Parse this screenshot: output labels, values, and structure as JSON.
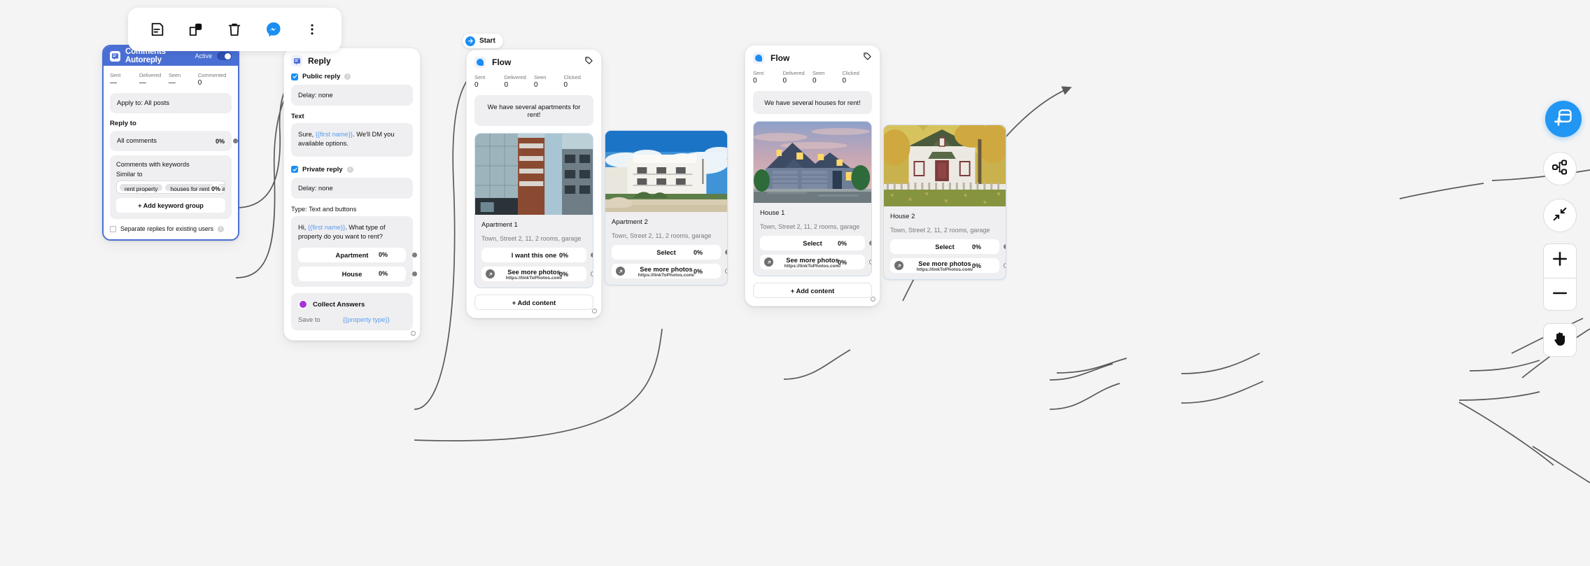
{
  "toolbar": {
    "buttons": [
      {
        "name": "notes-icon",
        "label": "Notes"
      },
      {
        "name": "duplicate-icon",
        "label": "Duplicate"
      },
      {
        "name": "trash-icon",
        "label": "Delete"
      },
      {
        "name": "messenger-icon",
        "label": "Messenger"
      },
      {
        "name": "more-vertical-icon",
        "label": "More"
      }
    ]
  },
  "start_badge": {
    "label": "Start"
  },
  "autoreply": {
    "title": "Comments Autoreply",
    "active_label": "Active",
    "stats": [
      {
        "label": "Sent",
        "value": "—"
      },
      {
        "label": "Delivered",
        "value": "—"
      },
      {
        "label": "Seen",
        "value": "—"
      },
      {
        "label": "Commented",
        "value": "0"
      }
    ],
    "apply_to": "Apply to: All posts",
    "reply_to_label": "Reply to",
    "all_comments": {
      "label": "All comments",
      "pct": "0%"
    },
    "keywords_block": {
      "title": "Comments with keywords",
      "similar_to_label": "Similar to",
      "chips": [
        "rent property",
        "houses for rent",
        "a"
      ],
      "pct": "0%",
      "add_button": "+ Add keyword group"
    },
    "separate_replies": "Separate replies for existing users"
  },
  "reply": {
    "title": "Reply",
    "public": {
      "label": "Public reply",
      "delay": "Delay:  none",
      "text_label": "Text",
      "message_prefix": "Sure, ",
      "message_var": "{{first name}}",
      "message_suffix": ". We'll DM you available options."
    },
    "private": {
      "label": "Private reply",
      "delay": "Delay:  none",
      "type": "Type:  Text and buttons",
      "message_prefix": "Hi, ",
      "message_var": "{{first name}}",
      "message_suffix": ". What type of property do you want to rent?",
      "buttons": [
        {
          "label": "Apartment",
          "pct": "0%"
        },
        {
          "label": "House",
          "pct": "0%"
        }
      ]
    },
    "collect": {
      "title": "Collect Answers",
      "save_to_label": "Save to",
      "save_to_value": "{{property type}}"
    }
  },
  "flow_apartments": {
    "title": "Flow",
    "stats": [
      {
        "label": "Sent",
        "value": "0"
      },
      {
        "label": "Delivered",
        "value": "0"
      },
      {
        "label": "Seen",
        "value": "0"
      },
      {
        "label": "Clicked",
        "value": "0"
      }
    ],
    "message": "We have several apartments for rent!",
    "add_content": "+ Add content",
    "card": {
      "name": "Apartment 1",
      "description": "Town, Street 2, 11, 2 rooms, garage",
      "buttons": [
        {
          "label": "I want this one",
          "pct": "0%",
          "sub": "",
          "link": false
        },
        {
          "label": "See more photos",
          "pct": "0%",
          "sub": "https://linkToPhotos.com/",
          "link": true
        }
      ]
    }
  },
  "apartment2": {
    "name": "Apartment 2",
    "description": "Town, Street 2, 11, 2 rooms, garage",
    "buttons": [
      {
        "label": "Select",
        "pct": "0%",
        "sub": "",
        "link": false
      },
      {
        "label": "See more photos",
        "pct": "0%",
        "sub": "https://linkToPhotos.com/",
        "link": true
      }
    ]
  },
  "flow_houses": {
    "title": "Flow",
    "stats": [
      {
        "label": "Sent",
        "value": "0"
      },
      {
        "label": "Delivered",
        "value": "0"
      },
      {
        "label": "Seen",
        "value": "0"
      },
      {
        "label": "Clicked",
        "value": "0"
      }
    ],
    "message": "We have several houses for rent!",
    "add_content": "+ Add content",
    "card": {
      "name": "House 1",
      "description": "Town, Street 2, 11, 2 rooms, garage",
      "buttons": [
        {
          "label": "Select",
          "pct": "0%",
          "sub": "",
          "link": false
        },
        {
          "label": "See more photos",
          "pct": "0%",
          "sub": "https://linkToPhotos.com/",
          "link": true
        }
      ]
    }
  },
  "house2": {
    "name": "House 2",
    "description": "Town, Street 2, 11, 2 rooms, garage",
    "buttons": [
      {
        "label": "Select",
        "pct": "0%",
        "sub": "",
        "link": false
      },
      {
        "label": "See more photos",
        "pct": "0%",
        "sub": "https://linkToPhotos.com/",
        "link": true
      }
    ]
  },
  "rail": {
    "add_block": "add-block-icon",
    "tree": "tree-layout-icon",
    "fit": "fit-to-screen-icon",
    "zoom_in": "plus-icon",
    "zoom_out": "minus-icon",
    "pan": "hand-icon"
  },
  "colors": {
    "accent_blue": "#1b8ef2",
    "card_blue": "#4a6fd4",
    "canvas": "#f4f4f4",
    "purple": "#a335d6"
  }
}
